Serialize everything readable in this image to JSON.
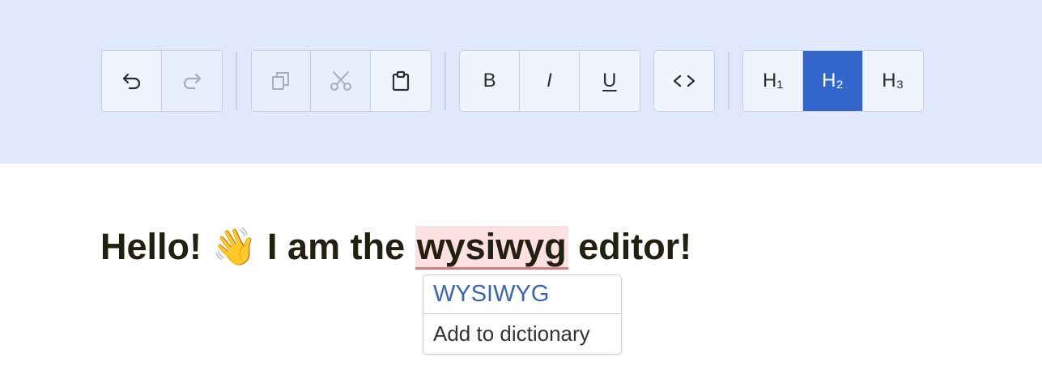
{
  "toolbar": {
    "undo": {
      "icon": "undo-icon"
    },
    "redo": {
      "icon": "redo-icon"
    },
    "copy": {
      "icon": "copy-icon"
    },
    "cut": {
      "icon": "scissors-icon"
    },
    "paste": {
      "icon": "clipboard-icon"
    },
    "bold_label": "B",
    "italic_label": "I",
    "underline_label": "U",
    "code": {
      "icon": "code-icon"
    },
    "h1_label": "H₁",
    "h2_label": "H₂",
    "h3_label": "H₃",
    "active_heading": "H2",
    "colors": {
      "toolbar_bg": "#e0e8fb",
      "active": "#3366cc",
      "disabled": "#a7acb7"
    }
  },
  "editor": {
    "text_before": "Hello! ",
    "emoji": "👋",
    "text_middle": " I am the ",
    "misspelled_word": "wysiwyg",
    "text_after": " editor!"
  },
  "spell_menu": {
    "suggestion": "WYSIWYG",
    "add_label": "Add to dictionary"
  }
}
